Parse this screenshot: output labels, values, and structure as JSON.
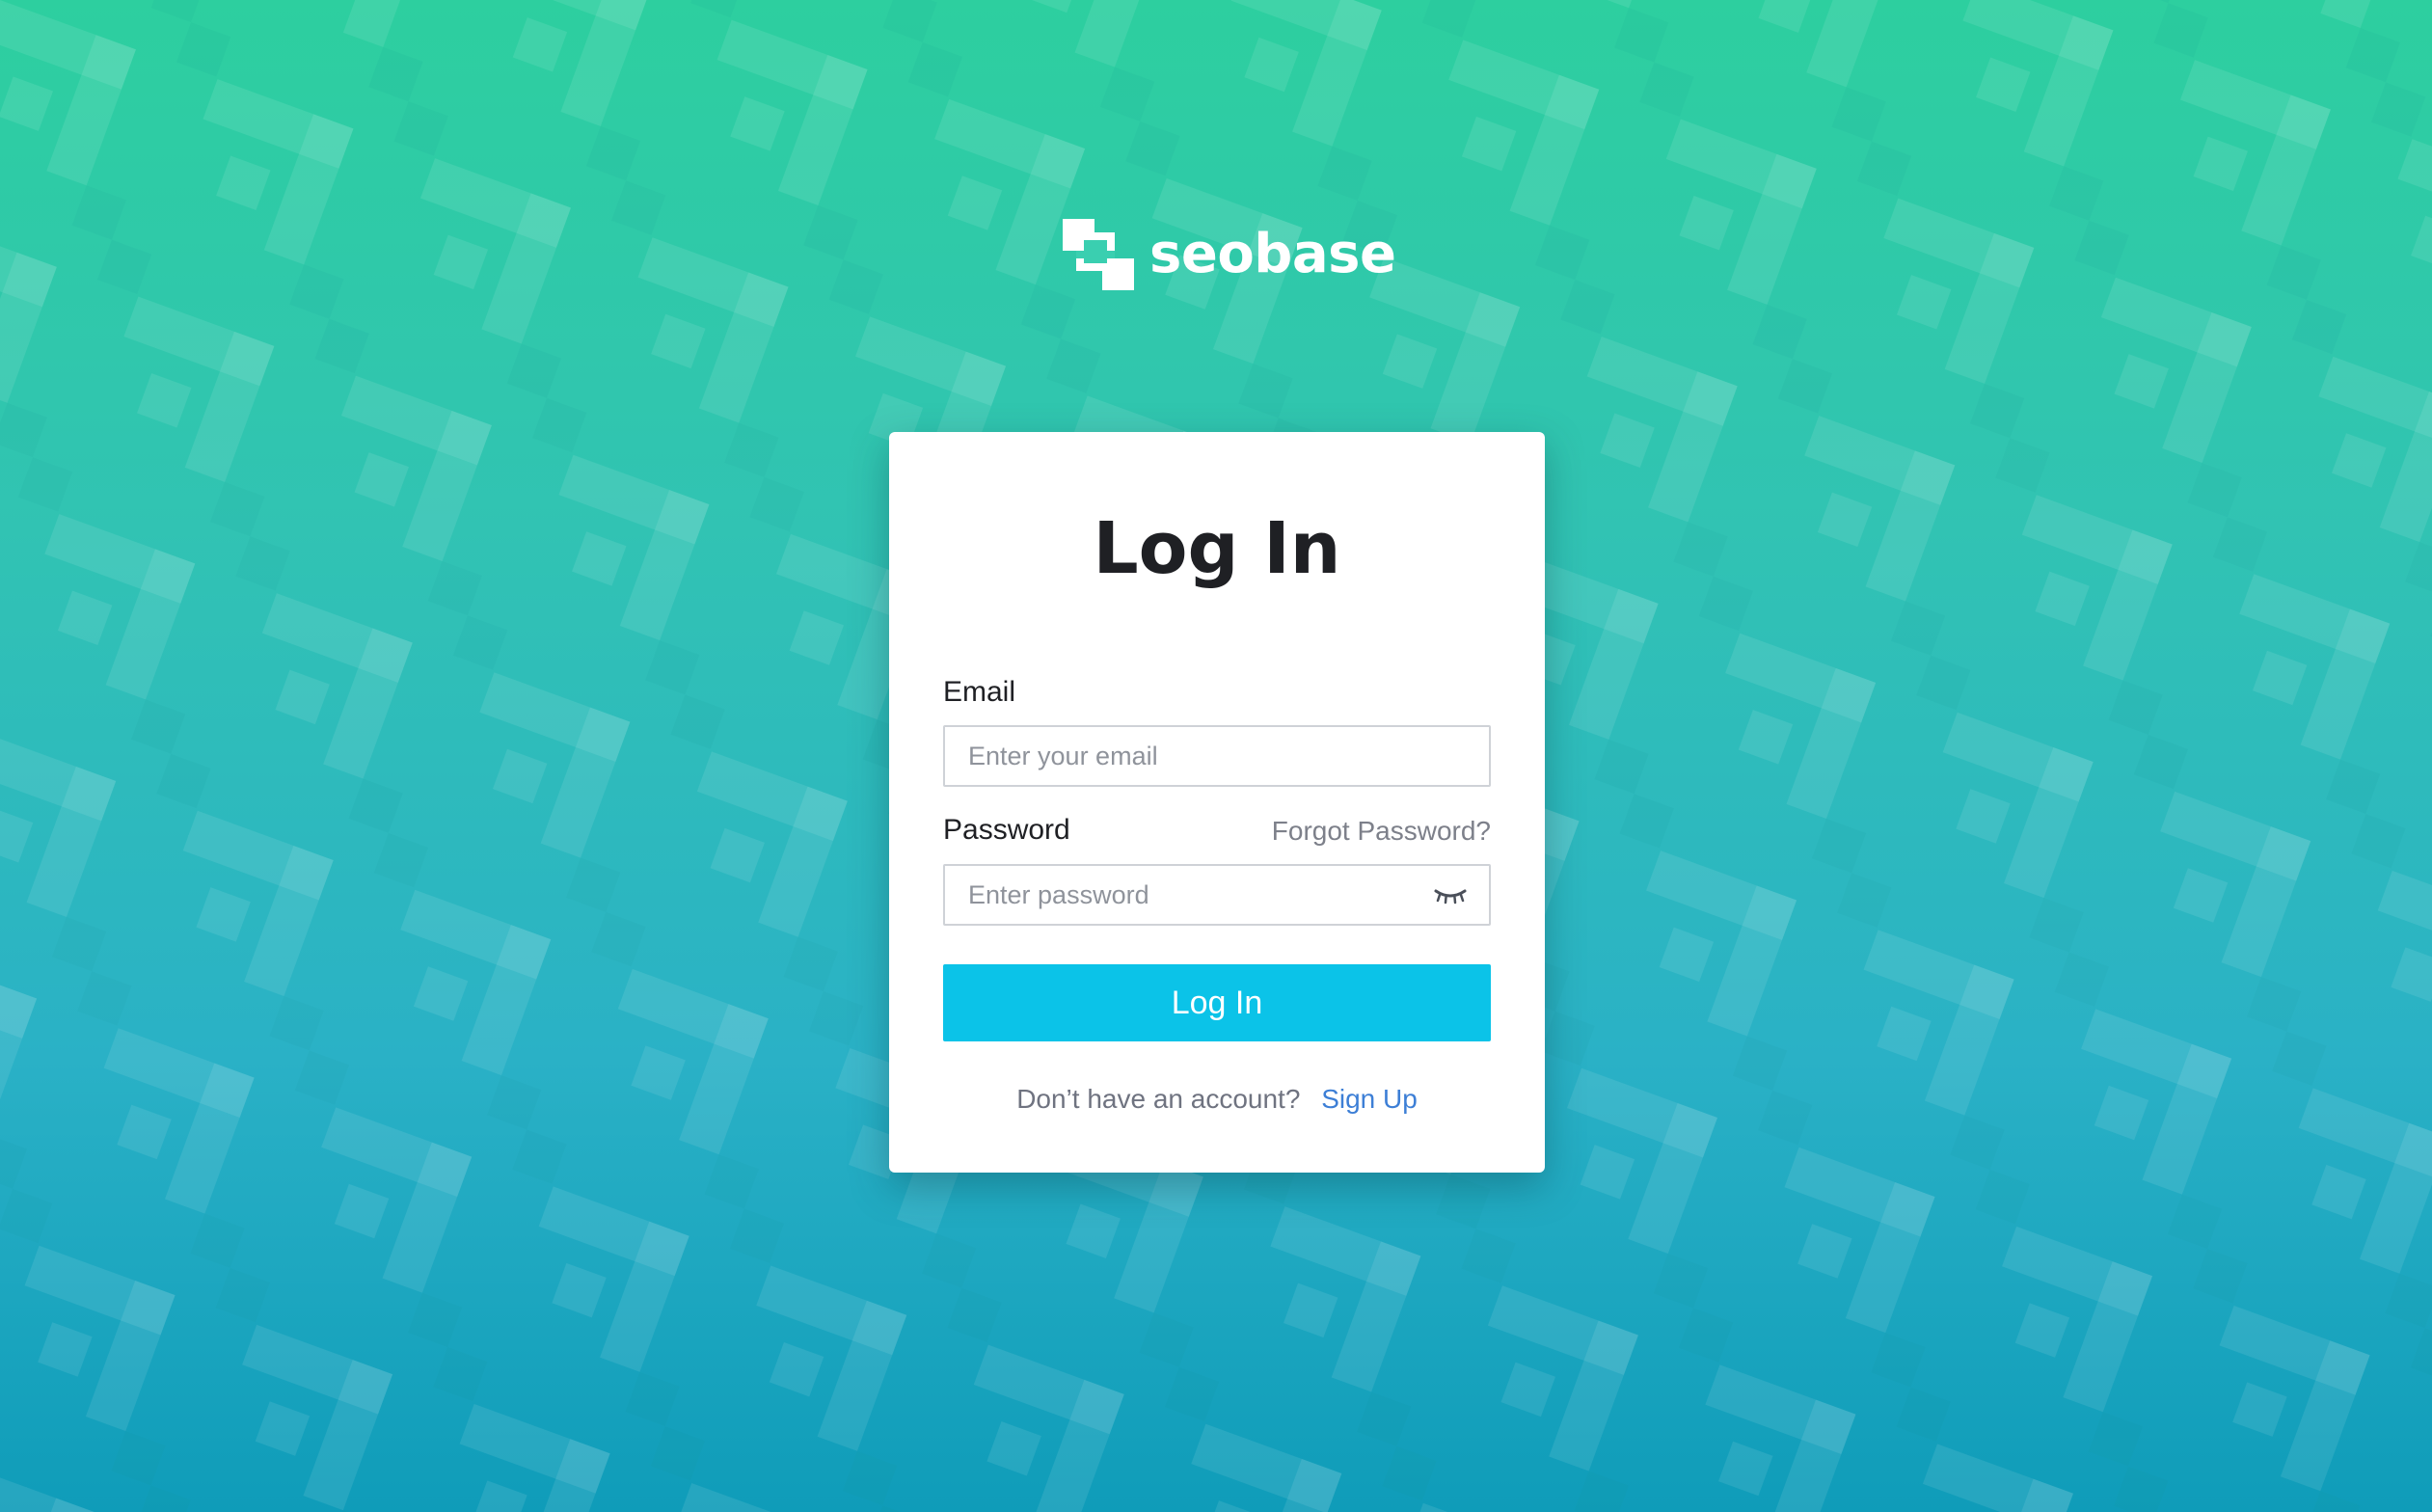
{
  "brand": {
    "name": "seobase",
    "logo_icon": "seobase-logo-icon"
  },
  "login": {
    "title": "Log In",
    "email": {
      "label": "Email",
      "value": "",
      "placeholder": "Enter your email"
    },
    "password": {
      "label": "Password",
      "value": "",
      "placeholder": "Enter password",
      "toggle_icon": "eye-closed-icon"
    },
    "forgot_password": "Forgot Password?",
    "submit_label": "Log In",
    "signup_prompt": "Don’t have an account?",
    "signup_link": "Sign Up"
  },
  "colors": {
    "button": "#0bc3e8",
    "link": "#3d7fd6",
    "background_top": "#2dcf9f",
    "background_bottom": "#0f9cb9"
  }
}
